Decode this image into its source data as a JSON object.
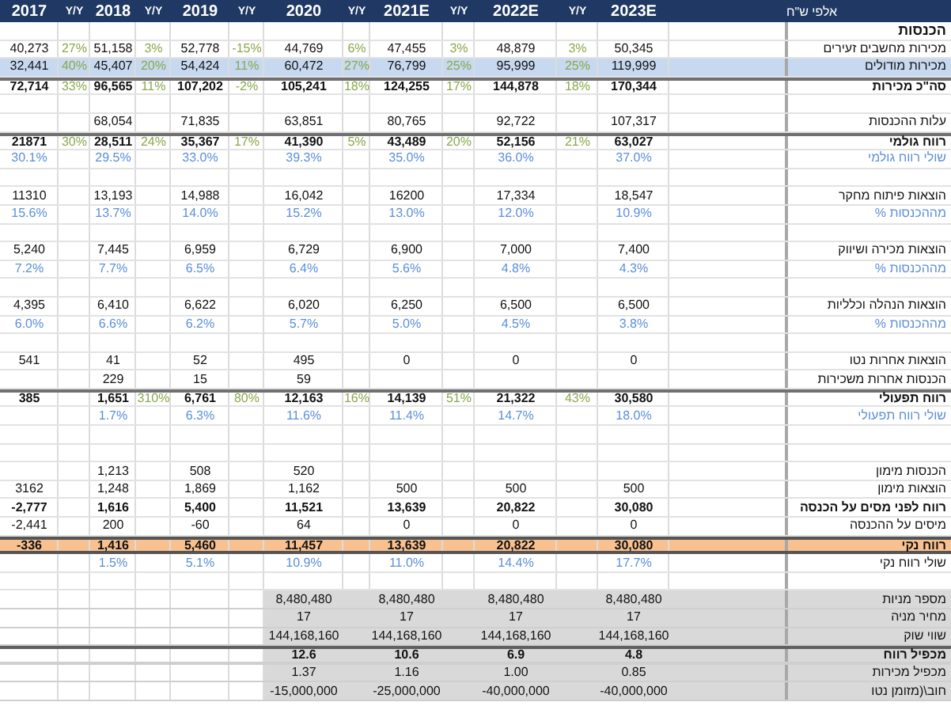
{
  "columns": [
    "2017",
    "Y/Y",
    "2018",
    "Y/Y",
    "2019",
    "Y/Y",
    "2020",
    "Y/Y",
    "2021E",
    "Y/Y",
    "2022E",
    "Y/Y",
    "2023E"
  ],
  "units": "אלפי ש\"ח",
  "rows": [
    {
      "kind": "section",
      "label": "הכנסות"
    },
    {
      "kind": "item",
      "label": "מכירות מחשבים זעירים",
      "cells": [
        "40,273",
        "27%",
        "51,158",
        "3%",
        "52,778",
        "-15%",
        "44,769",
        "6%",
        "47,455",
        "3%",
        "48,879",
        "3%",
        "50,345"
      ]
    },
    {
      "kind": "highlight",
      "label": "מכירות מודולים",
      "cells": [
        "32,441",
        "40%",
        "45,407",
        "20%",
        "54,424",
        "11%",
        "60,472",
        "27%",
        "76,799",
        "25%",
        "95,999",
        "25%",
        "119,999"
      ]
    },
    {
      "kind": "total",
      "label": "סה\"כ מכירות",
      "cells": [
        "72,714",
        "33%",
        "96,565",
        "11%",
        "107,202",
        "-2%",
        "105,241",
        "18%",
        "124,255",
        "17%",
        "144,878",
        "18%",
        "170,344"
      ]
    },
    {
      "kind": "blank"
    },
    {
      "kind": "item",
      "label": "עלות ההכנסות",
      "cells": [
        null,
        null,
        "68,054",
        null,
        "71,835",
        null,
        "63,851",
        null,
        "80,765",
        null,
        "92,722",
        null,
        "107,317"
      ]
    },
    {
      "kind": "total",
      "label": "רווח גולמי",
      "cells": [
        "21871",
        "30%",
        "28,511",
        "24%",
        "35,367",
        "17%",
        "41,390",
        "5%",
        "43,489",
        "20%",
        "52,156",
        "21%",
        "63,027"
      ]
    },
    {
      "kind": "percent",
      "label": "שולי רווח גולמי",
      "cells": [
        "30.1%",
        null,
        "29.5%",
        null,
        "33.0%",
        null,
        "39.3%",
        null,
        "35.0%",
        null,
        "36.0%",
        null,
        "37.0%"
      ]
    },
    {
      "kind": "blank"
    },
    {
      "kind": "item",
      "label": "הוצאות פיתוח מחקר",
      "cells": [
        "11310",
        null,
        "13,193",
        null,
        "14,988",
        null,
        "16,042",
        null,
        "16200",
        null,
        "17,334",
        null,
        "18,547"
      ]
    },
    {
      "kind": "percent",
      "label": "מההכנסות %",
      "cells": [
        "15.6%",
        null,
        "13.7%",
        null,
        "14.0%",
        null,
        "15.2%",
        null,
        "13.0%",
        null,
        "12.0%",
        null,
        "10.9%"
      ]
    },
    {
      "kind": "blank"
    },
    {
      "kind": "item",
      "label": "הוצאות מכירה ושיווק",
      "cells": [
        "5,240",
        null,
        "7,445",
        null,
        "6,959",
        null,
        "6,729",
        null,
        "6,900",
        null,
        "7,000",
        null,
        "7,400"
      ]
    },
    {
      "kind": "percent",
      "label": "מההכנסות %",
      "cells": [
        "7.2%",
        null,
        "7.7%",
        null,
        "6.5%",
        null,
        "6.4%",
        null,
        "5.6%",
        null,
        "4.8%",
        null,
        "4.3%"
      ]
    },
    {
      "kind": "blank"
    },
    {
      "kind": "item",
      "label": "הוצאות הנהלה וכלליות",
      "cells": [
        "4,395",
        null,
        "6,410",
        null,
        "6,622",
        null,
        "6,020",
        null,
        "6,250",
        null,
        "6,500",
        null,
        "6,500"
      ]
    },
    {
      "kind": "percent",
      "label": "מההכנסות %",
      "cells": [
        "6.0%",
        null,
        "6.6%",
        null,
        "6.2%",
        null,
        "5.7%",
        null,
        "5.0%",
        null,
        "4.5%",
        null,
        "3.8%"
      ]
    },
    {
      "kind": "blank"
    },
    {
      "kind": "item",
      "label": "הוצאות אחרות נטו",
      "cells": [
        "541",
        null,
        "41",
        null,
        "52",
        null,
        "495",
        null,
        "0",
        null,
        "0",
        null,
        "0"
      ]
    },
    {
      "kind": "item",
      "label": "הכנסות אחרות משכירות",
      "cells": [
        null,
        null,
        "229",
        null,
        "15",
        null,
        "59",
        null,
        null,
        null,
        null,
        null,
        null
      ]
    },
    {
      "kind": "total",
      "label": "רווח תפעולי",
      "cells": [
        "385",
        null,
        "1,651",
        "310%",
        "6,761",
        "80%",
        "12,163",
        "16%",
        "14,139",
        "51%",
        "21,322",
        "43%",
        "30,580"
      ]
    },
    {
      "kind": "percent",
      "label": "שולי רווח תפעולי",
      "cells": [
        null,
        null,
        "1.7%",
        null,
        "6.3%",
        null,
        "11.6%",
        null,
        "11.4%",
        null,
        "14.7%",
        null,
        "18.0%"
      ]
    },
    {
      "kind": "blank"
    },
    {
      "kind": "blank"
    },
    {
      "kind": "item",
      "label": "הכנסות מימון",
      "cells": [
        null,
        null,
        "1,213",
        null,
        "508",
        null,
        "520",
        null,
        null,
        null,
        null,
        null,
        null
      ]
    },
    {
      "kind": "item",
      "label": "הוצאות מימון",
      "cells": [
        "3162",
        null,
        "1,248",
        null,
        "1,869",
        null,
        "1,162",
        null,
        "500",
        null,
        "500",
        null,
        "500"
      ]
    },
    {
      "kind": "bold",
      "label": "רווח לפני מסים על הכנסה",
      "cells": [
        "-2,777",
        null,
        "1,616",
        null,
        "5,400",
        null,
        "11,521",
        null,
        "13,639",
        null,
        "20,822",
        null,
        "30,080"
      ]
    },
    {
      "kind": "item",
      "label": "מיסים על ההכנסה",
      "cells": [
        "-2,441",
        null,
        "200",
        null,
        "-60",
        null,
        "64",
        null,
        "0",
        null,
        "0",
        null,
        "0"
      ]
    },
    {
      "kind": "net",
      "label": "רווח נקי",
      "cells": [
        "-336",
        null,
        "1,416",
        null,
        "5,460",
        null,
        "11,457",
        null,
        "13,639",
        null,
        "20,822",
        null,
        "30,080"
      ]
    },
    {
      "kind": "ratio",
      "label": "שולי רווח נקי",
      "cells": [
        null,
        null,
        "1.5%",
        null,
        "5.1%",
        null,
        "10.9%",
        null,
        "11.0%",
        null,
        "14.4%",
        null,
        "17.7%"
      ]
    },
    {
      "kind": "blank"
    },
    {
      "kind": "gray",
      "label": "מספר מניות",
      "cells": [
        null,
        null,
        null,
        null,
        null,
        null,
        "8,480,480",
        null,
        "8,480,480",
        null,
        "8,480,480",
        null,
        "8,480,480"
      ]
    },
    {
      "kind": "gray",
      "label": "מחיר  מניה",
      "cells": [
        null,
        null,
        null,
        null,
        null,
        null,
        "17",
        null,
        "17",
        null,
        "17",
        null,
        "17"
      ]
    },
    {
      "kind": "gray",
      "label": "שווי שוק",
      "cells": [
        null,
        null,
        null,
        null,
        null,
        null,
        "144,168,160",
        null,
        "144,168,160",
        null,
        "144,168,160",
        null,
        "144,168,160"
      ]
    },
    {
      "kind": "gray-total",
      "label": "מכפיל רווח",
      "cells": [
        null,
        null,
        null,
        null,
        null,
        null,
        "12.6",
        null,
        "10.6",
        null,
        "6.9",
        null,
        "4.8"
      ]
    },
    {
      "kind": "gray",
      "label": "מכפיל מכירות",
      "cells": [
        null,
        null,
        null,
        null,
        null,
        null,
        "1.37",
        null,
        "1.16",
        null,
        "1.00",
        null,
        "0.85"
      ]
    },
    {
      "kind": "gray",
      "label": "חוב\\(מזומן נטו",
      "cells": [
        null,
        null,
        null,
        null,
        null,
        null,
        "-15,000,000",
        null,
        "-25,000,000",
        null,
        "-40,000,000",
        null,
        "-40,000,000"
      ]
    }
  ]
}
